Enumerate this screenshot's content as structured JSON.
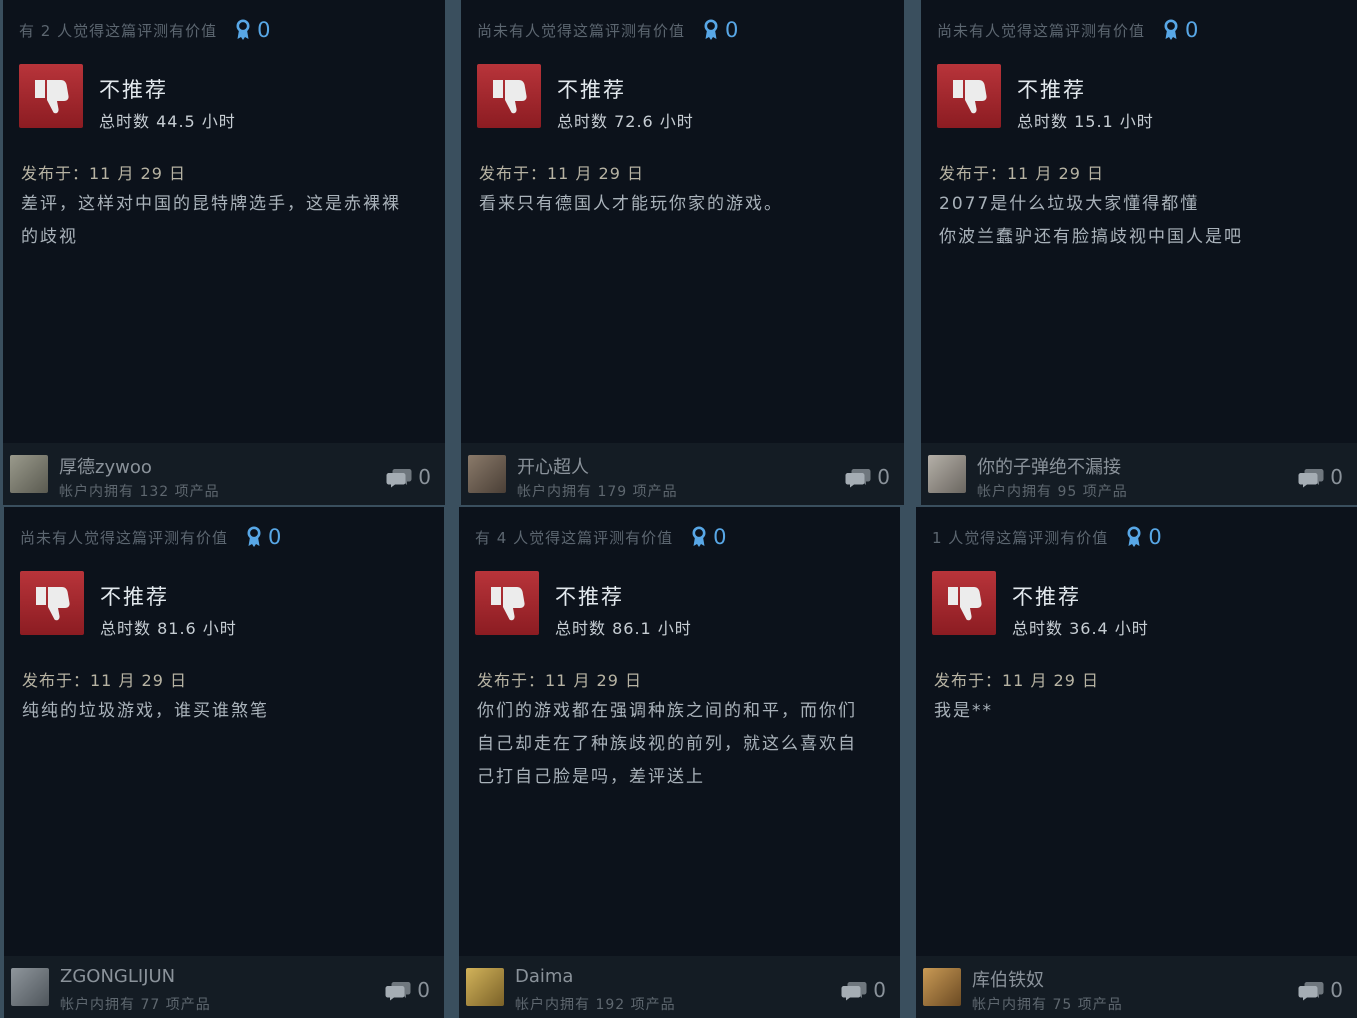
{
  "reviews": [
    {
      "helpful_text": "有 2 人觉得这篇评测有价值",
      "awards": "0",
      "verdict": "不推荐",
      "hours": "总时数 44.5 小时",
      "posted": "发布于：11 月 29 日",
      "body_lines": [
        "差评，这样对中国的昆特牌选手，这是赤裸裸",
        "的歧视"
      ],
      "author": "厚德zywoo",
      "products": "帐户内拥有 132 项产品",
      "comments": "0"
    },
    {
      "helpful_text": "尚未有人觉得这篇评测有价值",
      "awards": "0",
      "verdict": "不推荐",
      "hours": "总时数 72.6 小时",
      "posted": "发布于：11 月 29 日",
      "body_lines": [
        "看来只有德国人才能玩你家的游戏。"
      ],
      "author": "开心超人",
      "products": "帐户内拥有 179 项产品",
      "comments": "0"
    },
    {
      "helpful_text": "尚未有人觉得这篇评测有价值",
      "awards": "0",
      "verdict": "不推荐",
      "hours": "总时数 15.1 小时",
      "posted": "发布于：11 月 29 日",
      "body_lines": [
        "2077是什么垃圾大家懂得都懂",
        "你波兰蠢驴还有脸搞歧视中国人是吧"
      ],
      "author": "你的子弹绝不漏接",
      "products": "帐户内拥有 95 项产品",
      "comments": "0"
    },
    {
      "helpful_text": "尚未有人觉得这篇评测有价值",
      "awards": "0",
      "verdict": "不推荐",
      "hours": "总时数 81.6 小时",
      "posted": "发布于：11 月 29 日",
      "body_lines": [
        "纯纯的垃圾游戏，谁买谁煞笔"
      ],
      "author": "ZGONGLIJUN",
      "products": "帐户内拥有 77 项产品",
      "comments": "0"
    },
    {
      "helpful_text": "有 4 人觉得这篇评测有价值",
      "awards": "0",
      "verdict": "不推荐",
      "hours": "总时数 86.1 小时",
      "posted": "发布于：11 月 29 日",
      "body_lines": [
        "你们的游戏都在强调种族之间的和平，而你们",
        "自己却走在了种族歧视的前列，就这么喜欢自",
        "己打自己脸是吗，差评送上"
      ],
      "author": "Daima",
      "products": "帐户内拥有 192 项产品",
      "comments": "0"
    },
    {
      "helpful_text": "1 人觉得这篇评测有价值",
      "awards": "0",
      "verdict": "不推荐",
      "hours": "总时数 36.4 小时",
      "posted": "发布于：11 月 29 日",
      "body_lines": [
        "我是**"
      ],
      "author": "库伯铁奴",
      "products": "帐户内拥有 75 项产品",
      "comments": "0"
    }
  ],
  "icons": {
    "thumb": "thumbs-down-icon",
    "award": "award-ribbon-icon",
    "comment": "comment-bubbles-icon"
  },
  "colors": {
    "card_bg": "#0c121b",
    "thumb_red": "#b8343a",
    "award_blue": "#58a7e6"
  }
}
